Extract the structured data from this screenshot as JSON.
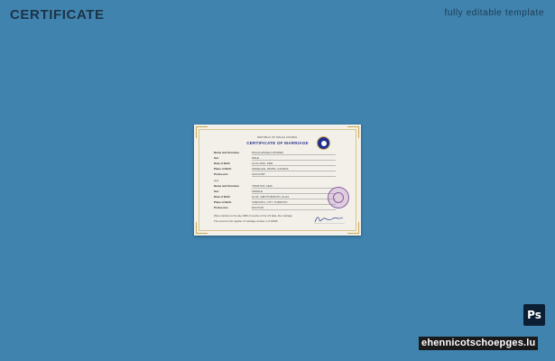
{
  "header": {
    "title": "CERTIFICATE",
    "subtitle": "fully editable template"
  },
  "certificate": {
    "state_line": "REPUBLIC OF MAHAL KINABAL",
    "title": "CERTIFICATE OF MARRIAGE",
    "groom": [
      {
        "label": "Name and Surname",
        "value": "PALHA ANGELO BOWER"
      },
      {
        "label": "Sex",
        "value": "MALE"
      },
      {
        "label": "Date of Birth",
        "value": "12.01.2010. 1982"
      },
      {
        "label": "Place of Birth",
        "value": "ANGELIAN, WHITE, CANADA"
      },
      {
        "label": "Profession",
        "value": "ACCOUNT"
      }
    ],
    "bride_label": "and",
    "bride": [
      {
        "label": "Name and Surname",
        "value": "TRANTON, FEIA"
      },
      {
        "label": "Sex",
        "value": "FEMALE"
      },
      {
        "label": "Date of Birth",
        "value": "12.01. 1997/TORONTO, ALLIA"
      },
      {
        "label": "Place of Birth",
        "value": "TORONTO, CITY, TORONTO"
      },
      {
        "label": "Profession",
        "value": "DOCTOR"
      }
    ],
    "footnote_1": "Were married on the day 1999 of events on the 1/3 date, the marriage.",
    "footnote_2": "The record in the register of marriage number 1 of 10025"
  },
  "badges": {
    "ps_label": "Ps",
    "watermark": "ehennicotschoepges.lu"
  }
}
